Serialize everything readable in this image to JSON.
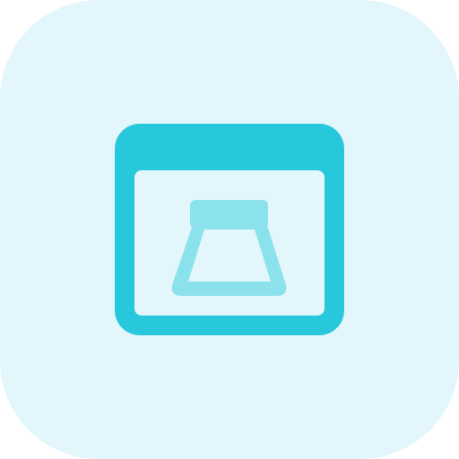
{
  "icon": {
    "name": "browser-window-lampshade-icon",
    "colors": {
      "tile_background": "#e2f6fb",
      "window_frame": "#27c8db",
      "window_content": "#e2f6fb",
      "lamp_fill": "#8ce2ec"
    }
  }
}
